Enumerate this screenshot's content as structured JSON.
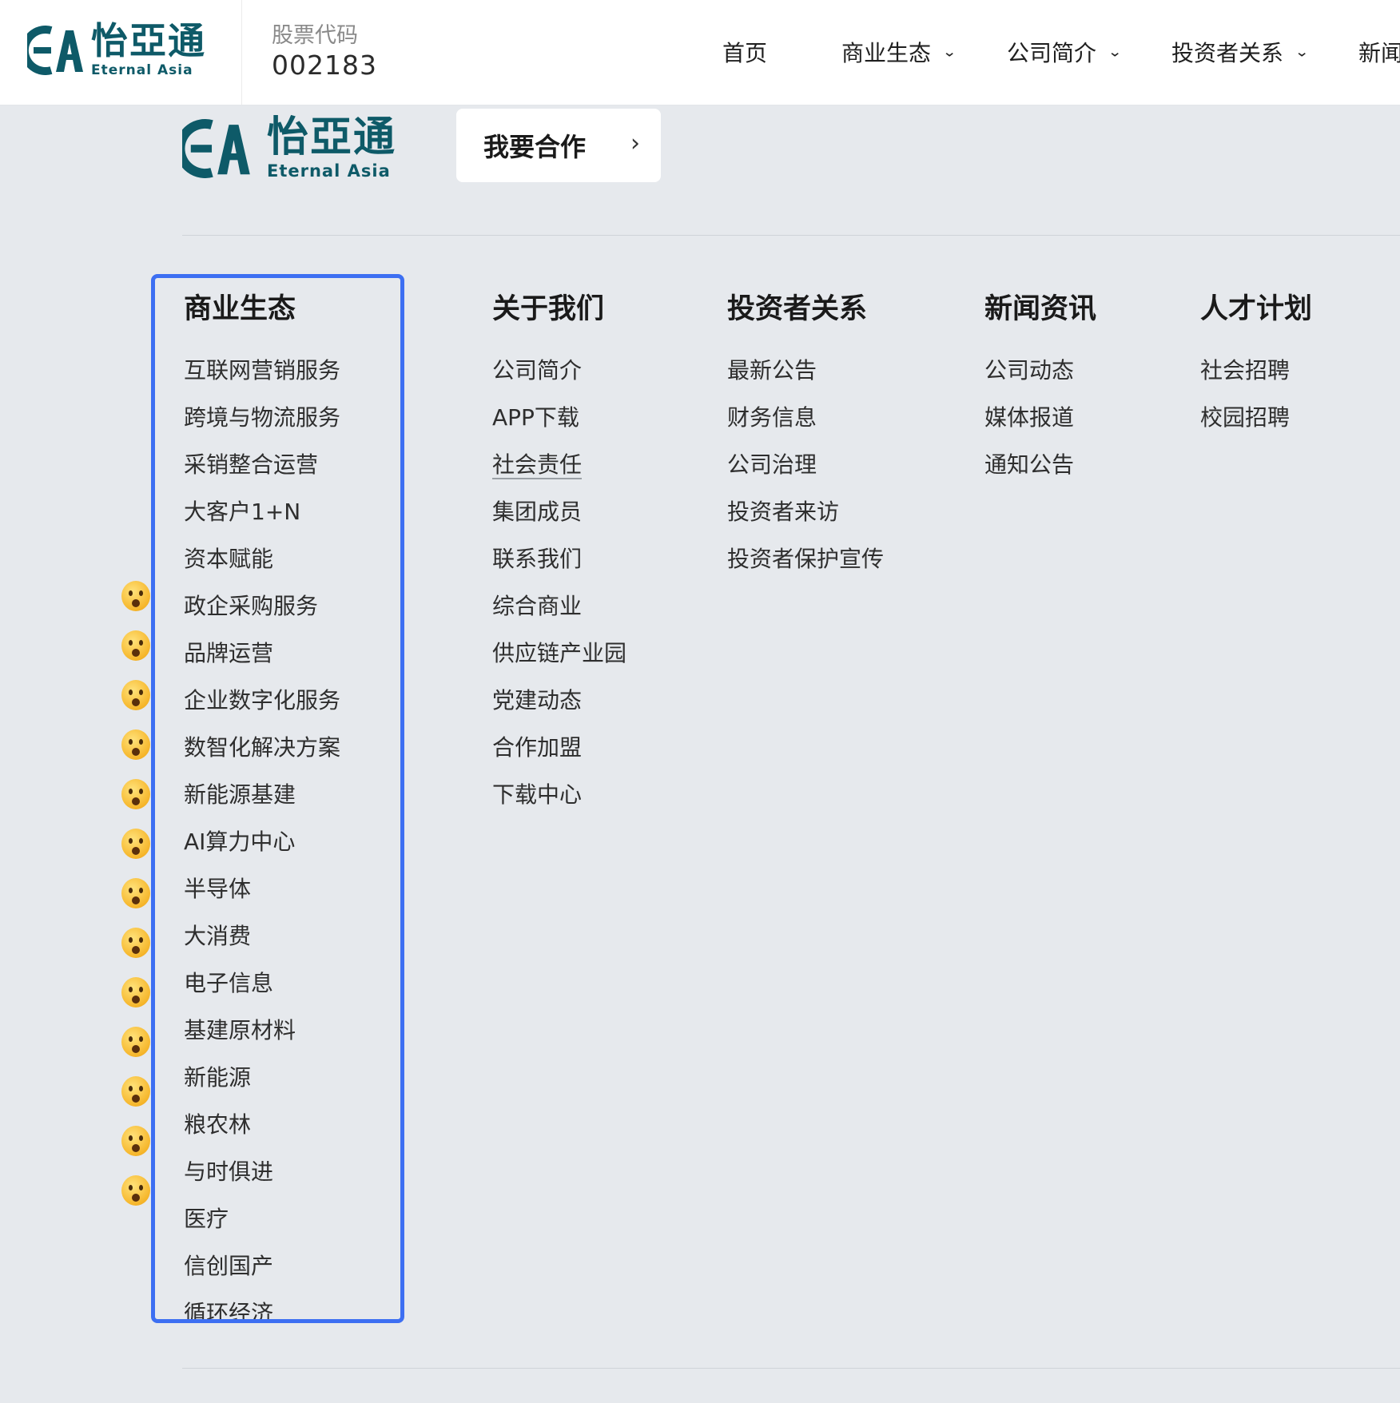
{
  "header": {
    "brand_cn": "怡亞通",
    "brand_en": "Eternal Asia",
    "stock_label": "股票代码",
    "stock_code": "002183",
    "nav": [
      {
        "label": "首页"
      },
      {
        "label": "商业生态"
      },
      {
        "label": "公司简介"
      },
      {
        "label": "投资者关系"
      },
      {
        "label": "新闻"
      }
    ]
  },
  "panel": {
    "brand_cn": "怡亞通",
    "brand_en": "Eternal Asia",
    "cooperate_label": "我要合作",
    "columns": [
      {
        "title": "商业生态",
        "items": [
          "互联网营销服务",
          "跨境与物流服务",
          "采销整合运营",
          "大客户1+N",
          "资本赋能",
          "政企采购服务",
          "品牌运营",
          "企业数字化服务",
          "数智化解决方案",
          "新能源基建",
          "AI算力中心",
          "半导体",
          "大消费",
          "电子信息",
          "基建原材料",
          "新能源",
          "粮农林",
          "与时俱进",
          "医疗",
          "信创国产",
          "循环经济"
        ]
      },
      {
        "title": "关于我们",
        "items": [
          "公司简介",
          "APP下载",
          "社会责任",
          "集团成员",
          "联系我们",
          "综合商业",
          "供应链产业园",
          "党建动态",
          "合作加盟",
          "下载中心"
        ]
      },
      {
        "title": "投资者关系",
        "items": [
          "最新公告",
          "财务信息",
          "公司治理",
          "投资者来访",
          "投资者保护宣传"
        ]
      },
      {
        "title": "新闻资讯",
        "items": [
          "公司动态",
          "媒体报道",
          "通知公告"
        ]
      },
      {
        "title": "人才计划",
        "items": [
          "社会招聘",
          "校园招聘"
        ]
      }
    ]
  },
  "colors": {
    "brand": "#0e5a68",
    "highlight": "#3d6ff2",
    "background": "#e6e9ed"
  },
  "icons": {
    "emoji": "astonished-face-icon",
    "chevron": "chevron-down-icon",
    "arrow": "chevron-right-icon"
  }
}
